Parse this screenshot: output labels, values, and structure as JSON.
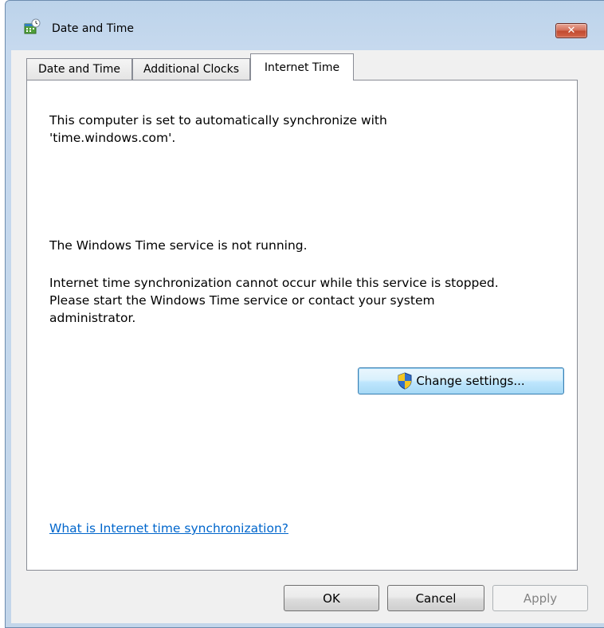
{
  "window": {
    "title": "Date and Time"
  },
  "tabs": [
    {
      "label": "Date and Time",
      "active": false
    },
    {
      "label": "Additional Clocks",
      "active": false
    },
    {
      "label": "Internet Time",
      "active": true
    }
  ],
  "panel": {
    "sync_line1": "This computer is set to automatically synchronize with",
    "sync_line2": "'time.windows.com'.",
    "status": "The Windows Time service is not running.",
    "detail_line1": "Internet time synchronization cannot occur while this service is stopped.",
    "detail_line2": "Please start the Windows Time service or contact your system",
    "detail_line3": "administrator.",
    "change_settings_label": "Change settings...",
    "help_link": "What is Internet time synchronization?"
  },
  "footer": {
    "ok_label": "OK",
    "cancel_label": "Cancel",
    "apply_label": "Apply"
  },
  "icons": {
    "app": "calendar-clock-icon",
    "close": "close-icon",
    "uac": "uac-shield-icon"
  },
  "colors": {
    "link": "#0066cc",
    "close_button": "#c24b30",
    "focus_button": "#3c7fb1"
  }
}
